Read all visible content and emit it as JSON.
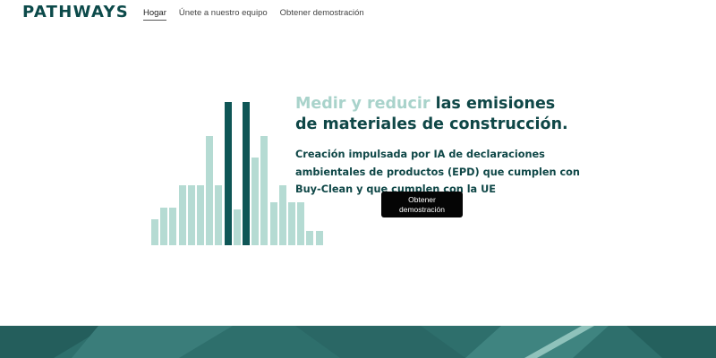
{
  "header": {
    "logo": "PATHWAYS",
    "nav": [
      {
        "label": "Hogar",
        "active": true
      },
      {
        "label": "Únete a nuestro equipo",
        "active": false
      },
      {
        "label": "Obtener demostración",
        "active": false
      }
    ]
  },
  "hero": {
    "headline_accent": "Medir y reducir",
    "headline_rest": " las emisiones de materiales de construcción.",
    "subheadline": "Creación impulsada por IA de declaraciones ambientales de productos (EPD) que cumplen con Buy-Clean y que cumplen con la UE",
    "cta_label": "Obtener demostración"
  },
  "graphic": {
    "bar_levels": [
      0.18,
      0.26,
      0.26,
      0.42,
      0.42,
      0.42,
      0.76,
      0.42,
      1.0,
      0.25,
      1.0,
      0.61,
      0.76,
      0.3,
      0.42,
      0.3,
      0.3,
      0.1,
      0.1
    ],
    "bar_dark": [
      false,
      false,
      false,
      false,
      false,
      false,
      false,
      false,
      true,
      false,
      true,
      false,
      false,
      false,
      false,
      false,
      false,
      false,
      false
    ]
  },
  "colors": {
    "brand_dark": "#0c4a4a",
    "bar_dark": "#0f5656",
    "bar_light": "#b5dbd3",
    "accent_text": "#a9d3cb",
    "cta_bg": "#050505",
    "footer_bg": "#2e6f6c"
  }
}
